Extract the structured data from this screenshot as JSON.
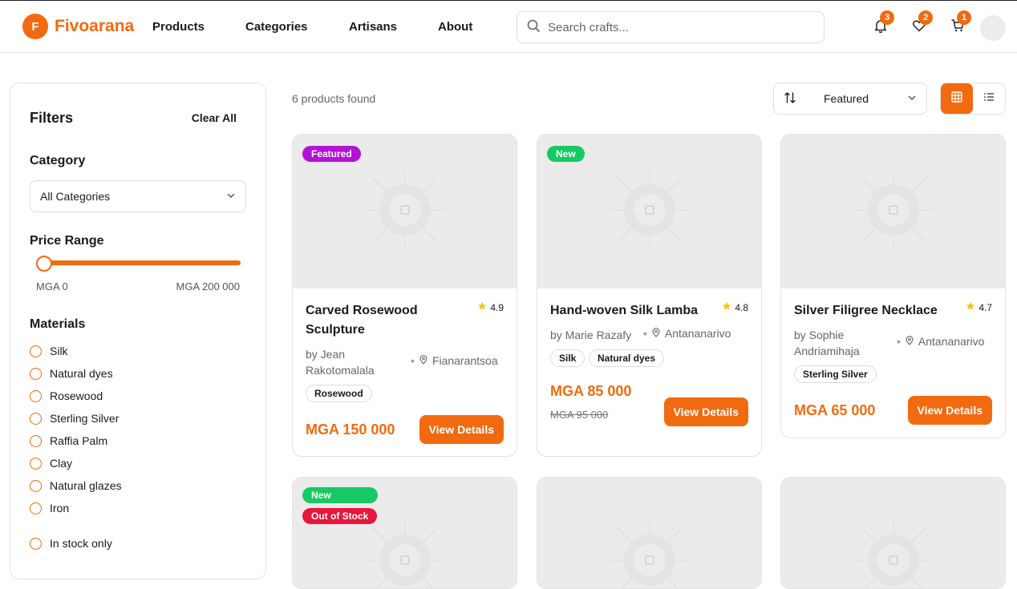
{
  "brand": {
    "logo_letter": "F",
    "name": "Fivoarana",
    "accent": "#f26a0f"
  },
  "nav": {
    "products": "Products",
    "categories": "Categories",
    "artisans": "Artisans",
    "about": "About"
  },
  "search": {
    "placeholder": "Search crafts..."
  },
  "badges": {
    "notifications": "3",
    "wishlist": "2",
    "cart": "1"
  },
  "filters": {
    "title": "Filters",
    "clear_all": "Clear All",
    "category_title": "Category",
    "category_value": "All Categories",
    "price_title": "Price Range",
    "price_min": "MGA 0",
    "price_max": "MGA 200 000",
    "materials_title": "Materials",
    "materials": [
      "Silk",
      "Natural dyes",
      "Rosewood",
      "Sterling Silver",
      "Raffia Palm",
      "Clay",
      "Natural glazes",
      "Iron"
    ],
    "in_stock": "In stock only"
  },
  "results": {
    "count_text": "6 products found",
    "sort_value": "Featured"
  },
  "tag_colors": {
    "featured": "#b512d9",
    "new": "#17c964",
    "out_of_stock": "#e8163c"
  },
  "products": [
    {
      "tag": "Featured",
      "title": "Carved Rosewood Sculpture",
      "rating": "4.9",
      "artisan": "by Jean Rakotomalala",
      "location": "Fianarantsoa",
      "materials": [
        "Rosewood"
      ],
      "price": "MGA 150 000",
      "old_price": "",
      "button": "View Details"
    },
    {
      "tag": "New",
      "title": "Hand-woven Silk Lamba",
      "rating": "4.8",
      "artisan": "by Marie Razafy",
      "location": "Antananarivo",
      "materials": [
        "Silk",
        "Natural dyes"
      ],
      "price": "MGA 85 000",
      "old_price": "MGA 95 000",
      "button": "View Details"
    },
    {
      "tag": "",
      "title": "Silver Filigree Necklace",
      "rating": "4.7",
      "artisan": "by Sophie Andriamihaja",
      "location": "Antananarivo",
      "materials": [
        "Sterling Silver"
      ],
      "price": "MGA 65 000",
      "old_price": "",
      "button": "View Details"
    },
    {
      "tags": [
        "New",
        "Out of Stock"
      ]
    },
    {},
    {}
  ]
}
